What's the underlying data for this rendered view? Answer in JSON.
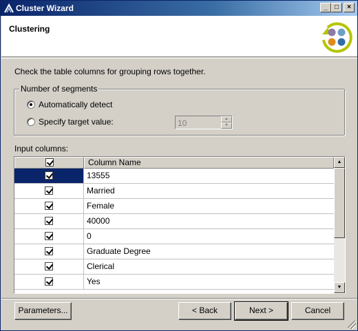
{
  "window": {
    "title": "Cluster Wizard",
    "controls": {
      "minimize": "_",
      "maximize": "□",
      "close": "×"
    }
  },
  "header": {
    "title": "Clustering",
    "logo_icon": "cluster-wizard-logo-icon"
  },
  "instruction": "Check the table columns for grouping rows together.",
  "segments": {
    "legend": "Number of segments",
    "options": [
      {
        "label": "Automatically detect",
        "selected": true
      },
      {
        "label": "Specify target value:",
        "selected": false
      }
    ],
    "target_value": "10"
  },
  "input_columns": {
    "label": "Input columns:",
    "header": {
      "checked": true,
      "column_name": "Column Name"
    },
    "rows": [
      {
        "checked": true,
        "name": "13555",
        "selected": true
      },
      {
        "checked": true,
        "name": "Married",
        "selected": false
      },
      {
        "checked": true,
        "name": "Female",
        "selected": false
      },
      {
        "checked": true,
        "name": "40000",
        "selected": false
      },
      {
        "checked": true,
        "name": "0",
        "selected": false
      },
      {
        "checked": true,
        "name": "Graduate Degree",
        "selected": false
      },
      {
        "checked": true,
        "name": "Clerical",
        "selected": false
      },
      {
        "checked": true,
        "name": "Yes",
        "selected": false
      }
    ]
  },
  "buttons": {
    "parameters": "Parameters...",
    "back": "< Back",
    "next": "Next >",
    "cancel": "Cancel"
  },
  "colors": {
    "titlebar": "#0a246a",
    "selection": "#0a246a",
    "face": "#d4d0c8"
  }
}
